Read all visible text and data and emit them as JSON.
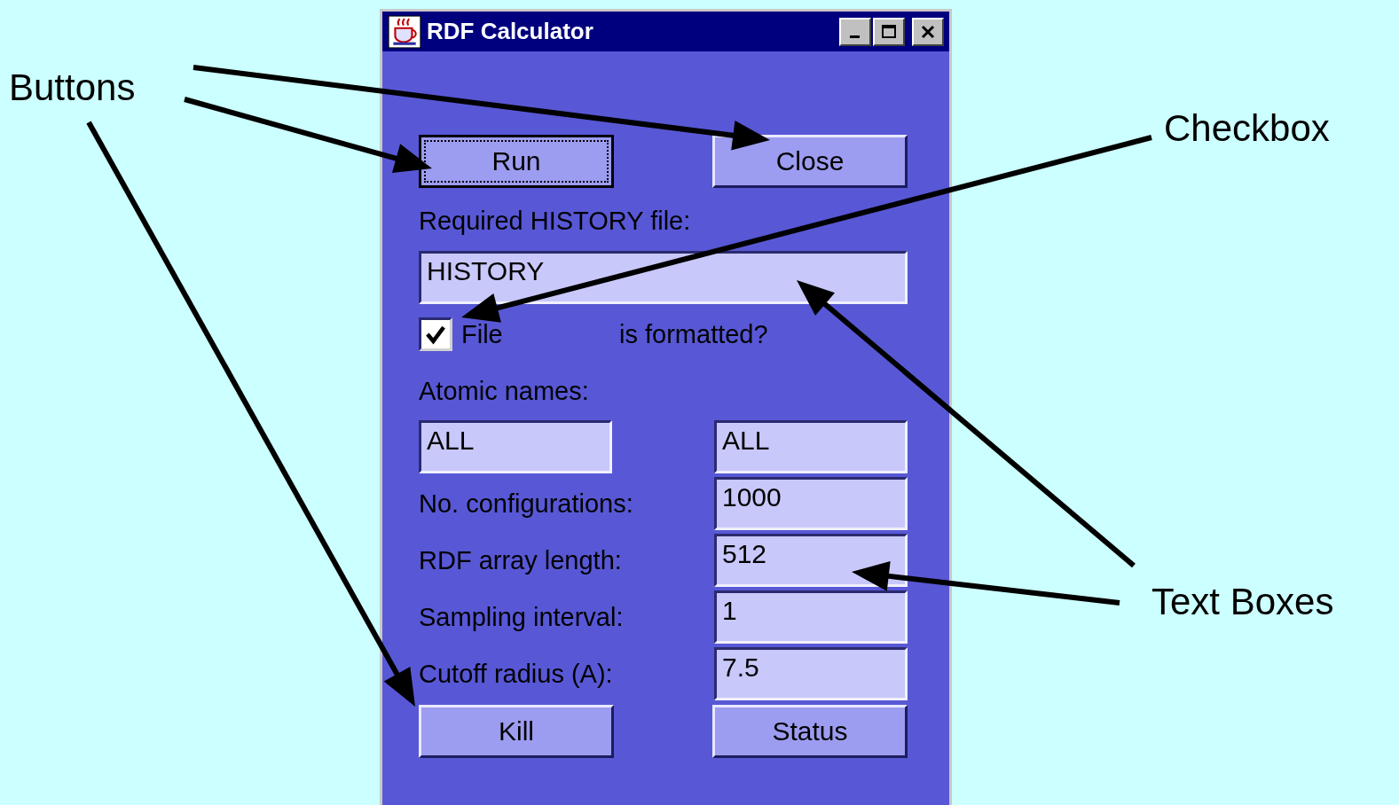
{
  "window": {
    "title": "RDF Calculator"
  },
  "top_buttons": [
    {
      "label": "Run",
      "focused": true
    },
    {
      "label": "Close",
      "focused": false
    }
  ],
  "history": {
    "label": "Required HISTORY file:",
    "value": "HISTORY"
  },
  "formatted": {
    "checked": true,
    "label": "File",
    "label_2": "is formatted?"
  },
  "atomic_names": {
    "label": "Atomic names:",
    "values": [
      "ALL",
      "ALL"
    ]
  },
  "parameters": [
    {
      "label": "No. configurations:",
      "value": "1000"
    },
    {
      "label": "RDF array length:",
      "value": "512"
    },
    {
      "label": "Sampling interval:",
      "value": "1"
    },
    {
      "label": "Cutoff radius (A):",
      "value": "7.5"
    }
  ],
  "bottom_buttons": [
    {
      "label": "Kill",
      "focused": false
    },
    {
      "label": "Status",
      "focused": false
    }
  ],
  "annotations": [
    {
      "text": "Buttons"
    },
    {
      "text": "Checkbox"
    },
    {
      "text": "Text Boxes"
    }
  ]
}
